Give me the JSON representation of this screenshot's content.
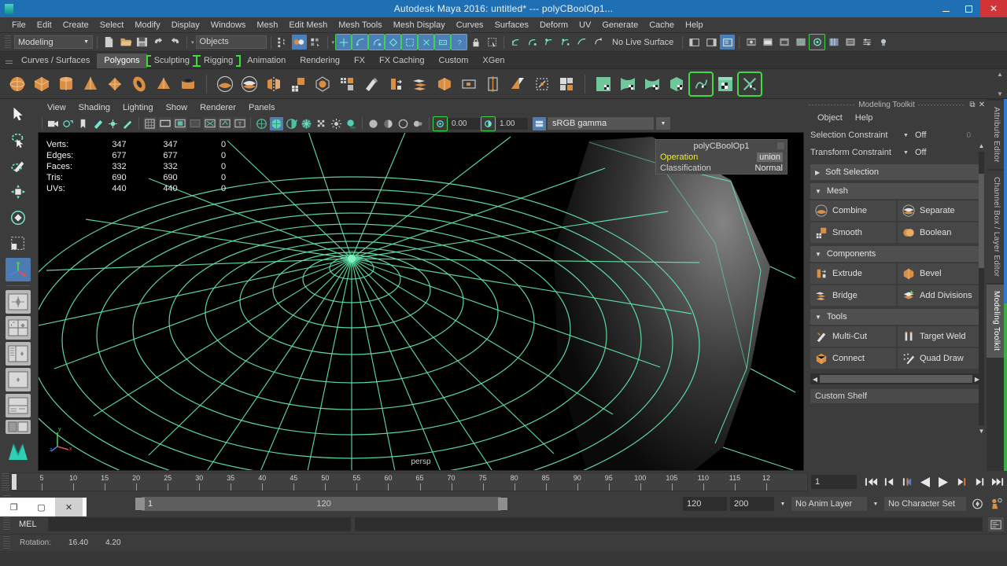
{
  "window": {
    "title": "Autodesk Maya 2016: untitled*  ---  polyCBoolOp1...",
    "minimize": "–",
    "maximize": "□",
    "close": "✕"
  },
  "menubar": {
    "items": [
      "File",
      "Edit",
      "Create",
      "Select",
      "Modify",
      "Display",
      "Windows",
      "Mesh",
      "Edit Mesh",
      "Mesh Tools",
      "Mesh Display",
      "Curves",
      "Surfaces",
      "Deform",
      "UV",
      "Generate",
      "Cache",
      "Help"
    ]
  },
  "statusline": {
    "menu_set": "Modeling",
    "object_field": "Objects",
    "no_live_surface": "No Live Surface",
    "icons": [
      "new-scene-icon",
      "open-scene-icon",
      "save-scene-icon",
      "undo-icon",
      "redo-icon",
      "select-hierarchy-icon",
      "select-object-icon",
      "select-component-icon",
      "snap-grid-icon",
      "snap-curve-icon",
      "snap-point-icon",
      "snap-projected-icon",
      "snap-view-plane-icon",
      "snap-uv-icon",
      "construction-history-icon",
      "render-current-icon",
      "ipr-render-icon",
      "render-settings-icon"
    ]
  },
  "shelf": {
    "tabs": [
      {
        "label": "Curves / Surfaces",
        "active": false,
        "bracket": false
      },
      {
        "label": "Polygons",
        "active": true,
        "bracket": false
      },
      {
        "label": "Sculpting",
        "active": false,
        "bracket": true
      },
      {
        "label": "Rigging",
        "active": false,
        "bracket": true
      },
      {
        "label": "Animation",
        "active": false,
        "bracket": false
      },
      {
        "label": "Rendering",
        "active": false,
        "bracket": false
      },
      {
        "label": "FX",
        "active": false,
        "bracket": false
      },
      {
        "label": "FX Caching",
        "active": false,
        "bracket": false
      },
      {
        "label": "Custom",
        "active": false,
        "bracket": false
      },
      {
        "label": "XGen",
        "active": false,
        "bracket": false
      }
    ],
    "icons": [
      "poly-sphere-icon",
      "poly-cube-icon",
      "poly-cylinder-icon",
      "poly-cone-icon",
      "poly-plane-icon",
      "poly-torus-icon",
      "poly-pyramid-icon",
      "poly-pipe-icon",
      "sep",
      "combine-icon",
      "separate-icon",
      "mirror-geometry-icon",
      "smooth-icon",
      "smooth-proxy-icon",
      "reduce-icon",
      "sculpt-icon",
      "extrude-icon",
      "bridge-icon",
      "bevel-icon",
      "append-polygon-icon",
      "insert-edge-loop-icon",
      "offset-edge-loop-icon",
      "multi-cut-icon",
      "quad-draw-icon",
      "sep",
      "uv-planar-icon",
      "uv-cylindrical-icon",
      "uv-spherical-icon",
      "uv-automatic-icon",
      "uv-unfold-icon",
      "uv-editor-icon",
      "uv-layout-icon"
    ]
  },
  "toolbox": {
    "tools": [
      {
        "name": "select-tool",
        "active": false
      },
      {
        "name": "lasso-select-tool",
        "active": false
      },
      {
        "name": "paint-select-tool",
        "active": false
      },
      {
        "name": "move-tool",
        "active": false
      },
      {
        "name": "rotate-tool",
        "active": false
      },
      {
        "name": "scale-tool",
        "active": false
      },
      {
        "name": "universal-manipulator-tool",
        "active": true
      }
    ],
    "layouts": [
      "single-perspective-layout",
      "four-view-layout",
      "outliner-persp-layout",
      "hypergraph-persp-layout",
      "persp-graph-layout",
      "two-pane-layout"
    ]
  },
  "viewport": {
    "menu": [
      "View",
      "Shading",
      "Lighting",
      "Show",
      "Renderer",
      "Panels"
    ],
    "exposure": "0.00",
    "gamma": "1.00",
    "color_space": "sRGB gamma",
    "camera_label": "persp",
    "hud": {
      "rows": [
        {
          "label": "Verts:",
          "c1": "347",
          "c2": "347",
          "c3": "0"
        },
        {
          "label": "Edges:",
          "c1": "677",
          "c2": "677",
          "c3": "0"
        },
        {
          "label": "Faces:",
          "c1": "332",
          "c2": "332",
          "c3": "0"
        },
        {
          "label": "Tris:",
          "c1": "690",
          "c2": "690",
          "c3": "0"
        },
        {
          "label": "UVs:",
          "c1": "440",
          "c2": "440",
          "c3": "0"
        }
      ]
    },
    "in_view_editor": {
      "title": "polyCBoolOp1",
      "rows": [
        {
          "key": "Operation",
          "value": "union",
          "highlight": true
        },
        {
          "key": "Classification",
          "value": "Normal",
          "highlight": false
        }
      ]
    }
  },
  "modeling_toolkit": {
    "panel_title": "Modeling Toolkit",
    "menu": [
      "Object",
      "Help"
    ],
    "selection_constraint": {
      "label": "Selection Constraint",
      "value": "Off",
      "number": "0"
    },
    "transform_constraint": {
      "label": "Transform Constraint",
      "value": "Off"
    },
    "soft_selection": "Soft Selection",
    "sections": [
      {
        "title": "Mesh",
        "buttons": [
          {
            "label": "Combine",
            "icon": "combine-icon"
          },
          {
            "label": "Separate",
            "icon": "separate-icon"
          },
          {
            "label": "Smooth",
            "icon": "smooth-icon"
          },
          {
            "label": "Boolean",
            "icon": "boolean-icon"
          }
        ]
      },
      {
        "title": "Components",
        "buttons": [
          {
            "label": "Extrude",
            "icon": "extrude-icon"
          },
          {
            "label": "Bevel",
            "icon": "bevel-icon"
          },
          {
            "label": "Bridge",
            "icon": "bridge-icon"
          },
          {
            "label": "Add Divisions",
            "icon": "add-divisions-icon"
          }
        ]
      },
      {
        "title": "Tools",
        "buttons": [
          {
            "label": "Multi-Cut",
            "icon": "multi-cut-icon"
          },
          {
            "label": "Target Weld",
            "icon": "target-weld-icon"
          },
          {
            "label": "Connect",
            "icon": "connect-icon"
          },
          {
            "label": "Quad Draw",
            "icon": "quad-draw-icon"
          }
        ]
      }
    ],
    "custom_shelf": "Custom Shelf"
  },
  "dock_tabs": [
    {
      "label": "Attribute Editor",
      "active": false
    },
    {
      "label": "Channel Box / Layer Editor",
      "active": false
    },
    {
      "label": "Modeling Toolkit",
      "active": true
    }
  ],
  "timeline": {
    "ticks": [
      "5",
      "10",
      "15",
      "20",
      "25",
      "30",
      "35",
      "40",
      "45",
      "50",
      "55",
      "60",
      "65",
      "70",
      "75",
      "80",
      "85",
      "90",
      "95",
      "100",
      "105",
      "110",
      "115",
      "12"
    ],
    "current_frame": "1",
    "playback_buttons": [
      "go-to-start-icon",
      "step-back-key-icon",
      "step-back-frame-icon",
      "play-backwards-icon",
      "play-forwards-icon",
      "step-forward-frame-icon",
      "step-forward-key-icon",
      "go-to-end-icon"
    ]
  },
  "range": {
    "start": "1",
    "end": "120",
    "playback_end": "120",
    "range_end": "200",
    "anim_layer": "No Anim Layer",
    "character_set": "No Character Set",
    "icons": [
      "auto-keyframe-icon",
      "animation-preferences-icon"
    ]
  },
  "window_controls": {
    "buttons": [
      "restore-icon",
      "maximize-icon",
      "close-icon"
    ]
  },
  "command_line": {
    "language": "MEL",
    "input_value": "",
    "output_value": "",
    "script_editor_icon": "script-editor-icon"
  },
  "help_line": {
    "label": "Rotation:",
    "value1": "16.40",
    "value2": "4.20"
  },
  "colors": {
    "title_bar": "#1f6fb5",
    "accent_green": "#3ddb3d",
    "accent_blue": "#4c7fb5",
    "accent_orange": "#e08a3c",
    "panel_bg": "#3c3c3c",
    "viewport_bg": "#000000",
    "wireframe": "#5fe3a8"
  }
}
